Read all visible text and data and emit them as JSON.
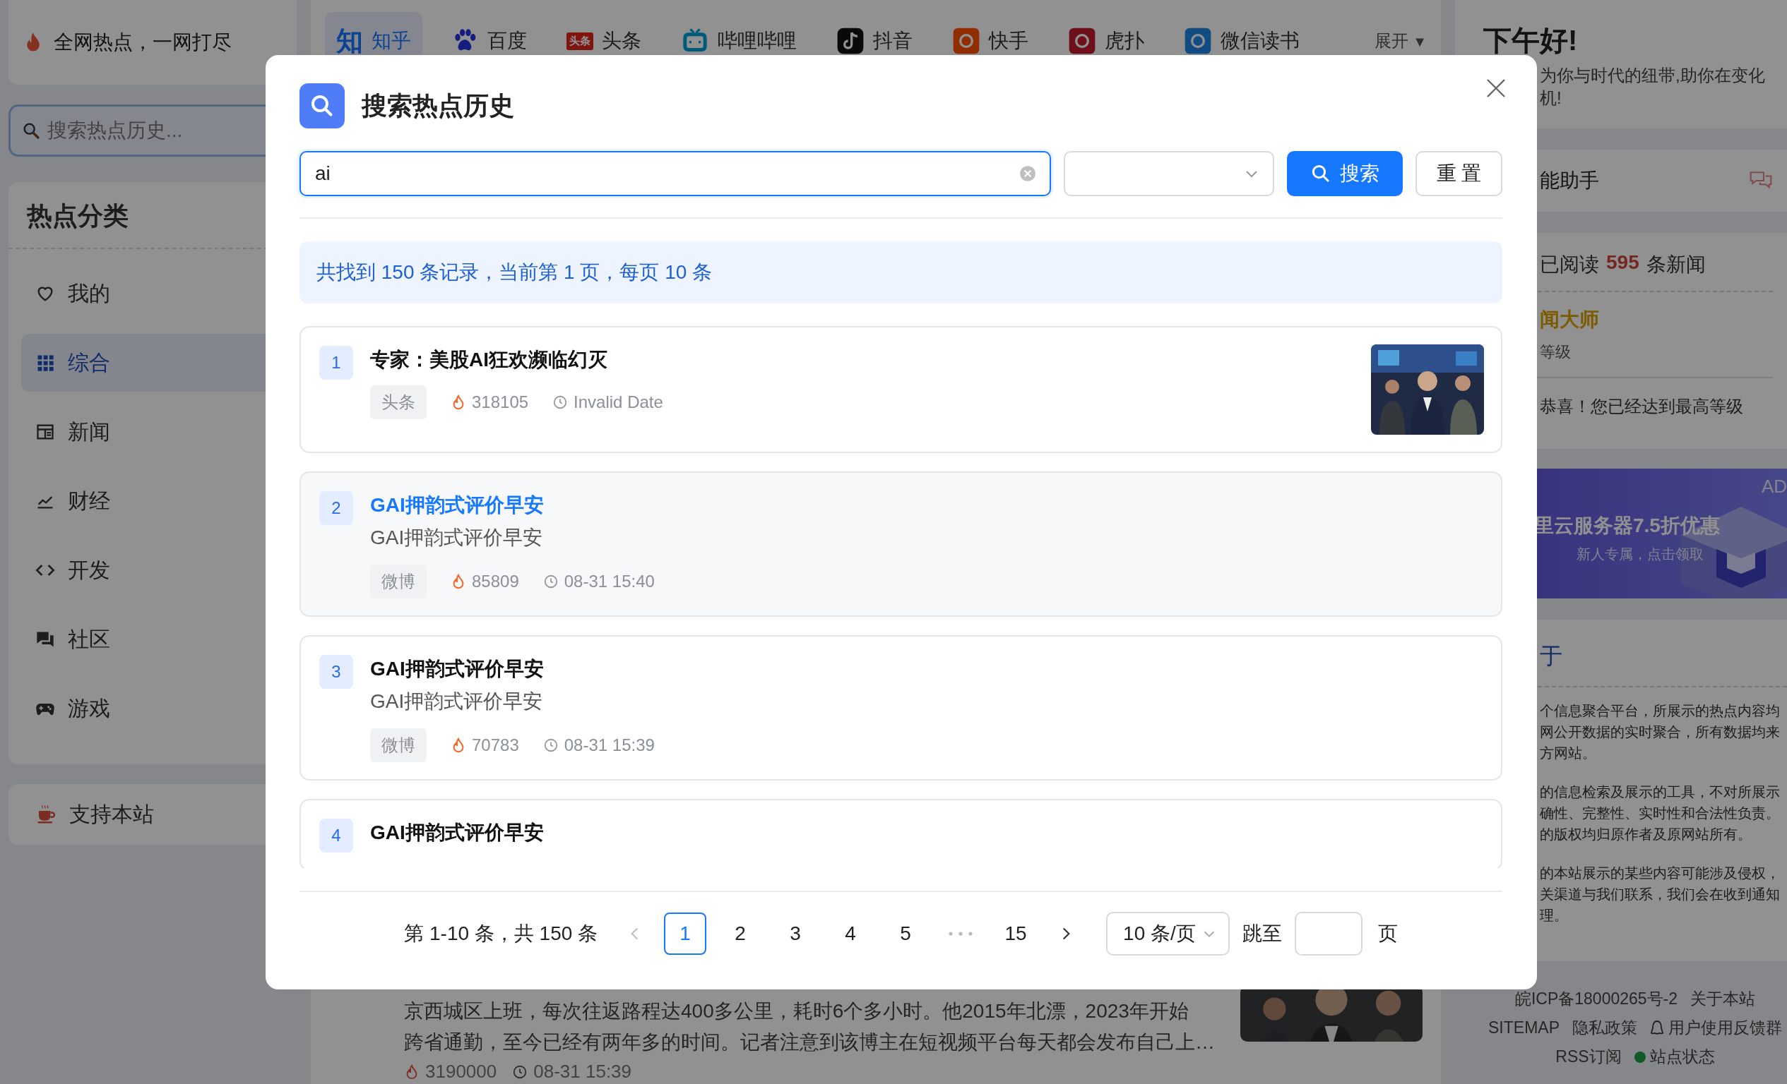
{
  "sidebar": {
    "logo": "全网热点，一网打尽",
    "search": {
      "placeholder": "搜索热点历史..."
    },
    "heading": "热点分类",
    "items": [
      {
        "label": "我的",
        "kind": "heart",
        "selected": false
      },
      {
        "label": "综合",
        "kind": "grid",
        "selected": true
      },
      {
        "label": "新闻",
        "kind": "news",
        "selected": false
      },
      {
        "label": "财经",
        "kind": "chart",
        "selected": false
      },
      {
        "label": "开发",
        "kind": "code",
        "selected": false
      },
      {
        "label": "社区",
        "kind": "chat",
        "selected": false
      },
      {
        "label": "游戏",
        "kind": "gamepad",
        "selected": false
      }
    ],
    "support": "支持本站"
  },
  "source_tabs": [
    {
      "label": "知乎",
      "selected": true,
      "icon": {
        "kind": "glyph",
        "text": "知"
      }
    },
    {
      "label": "百度",
      "selected": false,
      "icon": {
        "kind": "paw"
      }
    },
    {
      "label": "头条",
      "selected": false,
      "icon": {
        "kind": "badge",
        "text": "头条"
      }
    },
    {
      "label": "哔哩哔哩",
      "selected": false,
      "icon": {
        "kind": "tv"
      }
    },
    {
      "label": "抖音",
      "selected": false,
      "icon": {
        "kind": "note"
      }
    },
    {
      "label": "快手",
      "selected": false,
      "icon": {
        "kind": "square"
      }
    },
    {
      "label": "虎扑",
      "selected": false,
      "icon": {
        "kind": "square"
      }
    },
    {
      "label": "微信读书",
      "selected": false,
      "icon": {
        "kind": "square"
      }
    }
  ],
  "expand": {
    "label": "展开",
    "caret": "▼"
  },
  "background_news": {
    "lines": [
      "京西城区上班，每次往返路程达400多公里，耗时6个多小时。他2015年北漂，2023年开始",
      "跨省通勤，至今已经有两年多的时间。记者注意到该博主在短视频平台每天都会发布自己上…"
    ],
    "heat": "3190000",
    "time": "08-31 15:39",
    "thumbnail": true
  },
  "right_panel": {
    "greeting": "下午好!",
    "tagline": "为你与时代的纽带,助你在变化机!",
    "assistant": "能助手",
    "reading": {
      "prefix": "已阅读",
      "count": "595",
      "suffix": "条新闻"
    },
    "level_name": "闻大师",
    "level_caption": "等级",
    "level_message": "恭喜！您已经达到最高等级",
    "ad": {
      "badge": "AD",
      "title": "里云服务器7.5折优惠",
      "subtitle": "新人专属，点击领取"
    },
    "about": {
      "heading": "于",
      "paragraphs": [
        "个信息聚合平台，所展示的热点内容均网公开数据的实时聚合，所有数据均来方网站。",
        "的信息检索及展示的工具，不对所展示确性、完整性、实时性和合法性负责。的版权均归原作者及原网站所有。",
        "的本站展示的某些内容可能涉及侵权，关渠道与我们联系，我们会在收到通知理。"
      ]
    },
    "footer": {
      "icp": "皖ICP备18000265号-2",
      "about": "关于本站",
      "sitemap": "SITEMAP",
      "privacy": "隐私政策",
      "feedback": "用户使用反馈群",
      "rss": "RSS订阅",
      "status": "站点状态"
    }
  },
  "dialog": {
    "title": "搜索热点历史",
    "query": "ai",
    "search_button": "搜索",
    "reset_button": "重 置",
    "summary": "共找到 150 条记录，当前第 1 页，每页 10 条",
    "results": [
      {
        "rank": "1",
        "title": "专家：美股AI狂欢濒临幻灭",
        "source": "头条",
        "heat": "318105",
        "time": "Invalid Date",
        "highlighted": false,
        "thumbnail": true
      },
      {
        "rank": "2",
        "title": "GAI押韵式评价早安",
        "description": "GAI押韵式评价早安",
        "source": "微博",
        "heat": "85809",
        "time": "08-31 15:40",
        "highlighted": true,
        "thumbnail": false
      },
      {
        "rank": "3",
        "title": "GAI押韵式评价早安",
        "description": "GAI押韵式评价早安",
        "source": "微博",
        "heat": "70783",
        "time": "08-31 15:39",
        "highlighted": false,
        "thumbnail": false
      },
      {
        "rank": "4",
        "title": "GAI押韵式评价早安",
        "highlighted": false,
        "thumbnail": false
      }
    ],
    "pagination": {
      "range": "第 1-10 条，共 150 条",
      "prev_disabled": true,
      "next_disabled": false,
      "pages": [
        {
          "kind": "page",
          "label": "1",
          "selected": true
        },
        {
          "kind": "page",
          "label": "2",
          "selected": false
        },
        {
          "kind": "page",
          "label": "3",
          "selected": false
        },
        {
          "kind": "page",
          "label": "4",
          "selected": false
        },
        {
          "kind": "page",
          "label": "5",
          "selected": false
        },
        {
          "kind": "ellipsis"
        },
        {
          "kind": "page",
          "label": "15",
          "selected": false
        }
      ],
      "page_size": "10 条/页",
      "jump_label": "跳至",
      "jump_suffix": "页"
    }
  }
}
